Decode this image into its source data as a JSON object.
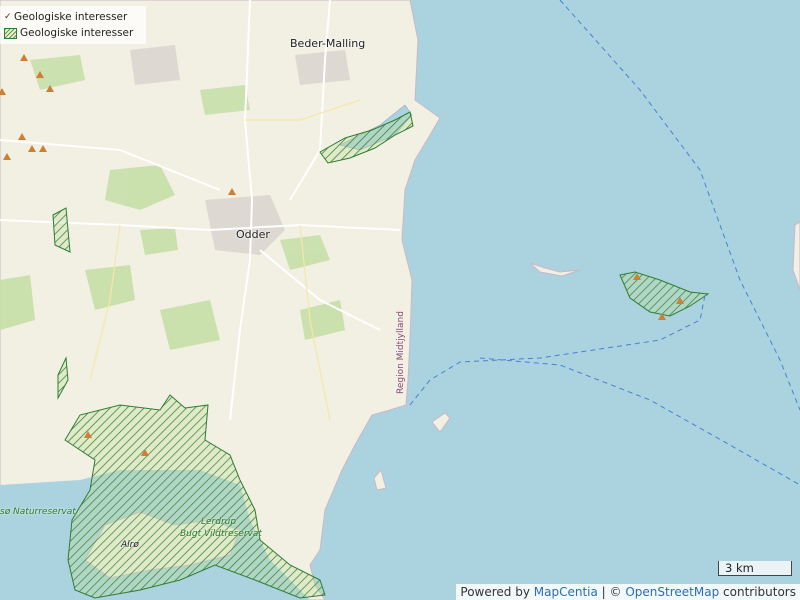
{
  "legend": {
    "items": [
      {
        "label": "Geologiske interesser",
        "type": "point"
      },
      {
        "label": "Geologiske interesser",
        "type": "polygon"
      }
    ]
  },
  "places": {
    "beder_malling": "Beder-Malling",
    "odder": "Odder",
    "alro": "Alrø",
    "region": "Region Midtjylland",
    "naturreservat": "sø Naturreservat",
    "lerdrup_1": "Lerdrup",
    "lerdrup_2": "Bugt Vildtreservat"
  },
  "scale": {
    "label": "3 km"
  },
  "attribution": {
    "prefix": "Powered by ",
    "mapcentia": "MapCentia",
    "sep": " | © ",
    "osm": "OpenStreetMap",
    "suffix": " contributors"
  },
  "colors": {
    "sea": "#aad3df",
    "land": "#f2efe3",
    "forest": "#b5d29c",
    "hatch": "#2e7d32",
    "marker": "#cd7f32"
  }
}
